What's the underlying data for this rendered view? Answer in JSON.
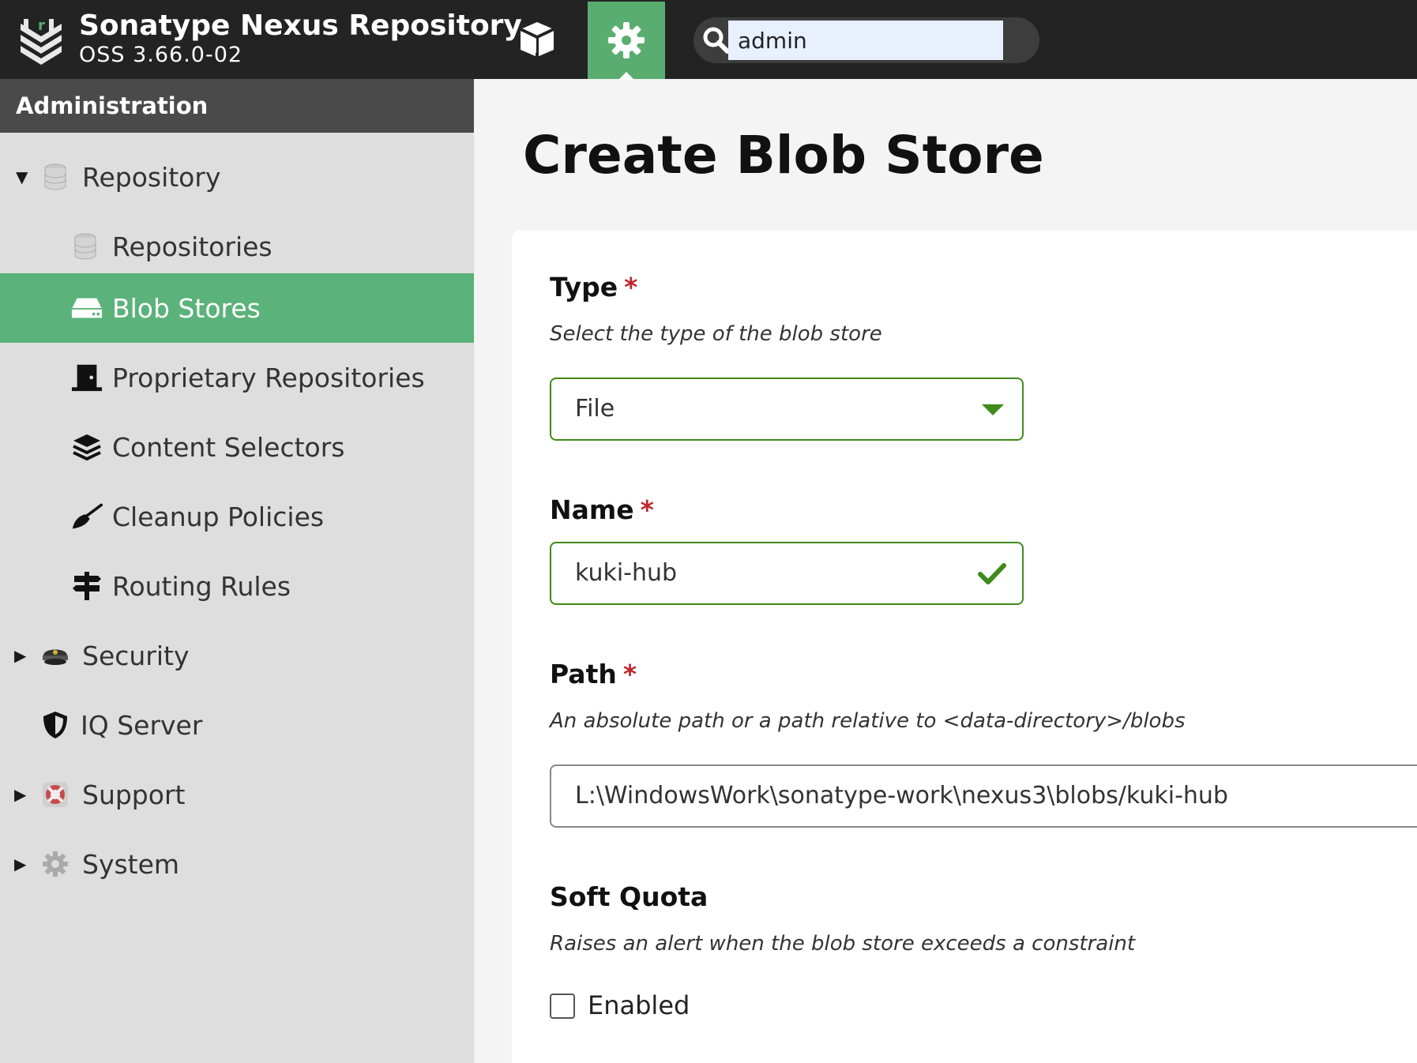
{
  "header": {
    "title": "Sonatype Nexus Repository",
    "version": "OSS 3.66.0-02",
    "search_value": "admin"
  },
  "sidebar": {
    "heading": "Administration",
    "items": [
      {
        "label": "Repository",
        "icon": "database-icon"
      },
      {
        "label": "Repositories",
        "icon": "database-icon"
      },
      {
        "label": "Blob Stores",
        "icon": "hard-drive-icon"
      },
      {
        "label": "Proprietary Repositories",
        "icon": "door-icon"
      },
      {
        "label": "Content Selectors",
        "icon": "layers-icon"
      },
      {
        "label": "Cleanup Policies",
        "icon": "broom-icon"
      },
      {
        "label": "Routing Rules",
        "icon": "signpost-icon"
      },
      {
        "label": "Security",
        "icon": "police-cap-icon"
      },
      {
        "label": "IQ Server",
        "icon": "shield-icon"
      },
      {
        "label": "Support",
        "icon": "lifebuoy-icon"
      },
      {
        "label": "System",
        "icon": "gear-icon"
      }
    ]
  },
  "main": {
    "title": "Create Blob Store",
    "type": {
      "label": "Type",
      "required": "*",
      "help": "Select the type of the blob store",
      "value": "File"
    },
    "name": {
      "label": "Name",
      "required": "*",
      "value": "kuki-hub"
    },
    "path": {
      "label": "Path",
      "required": "*",
      "help": "An absolute path or a path relative to <data-directory>/blobs",
      "value": "L:\\WindowsWork\\sonatype-work\\nexus3\\blobs/kuki-hub"
    },
    "soft_quota": {
      "label": "Soft Quota",
      "help": "Raises an alert when the blob store exceeds a constraint",
      "checkbox_label": "Enabled"
    }
  },
  "colors": {
    "accent_green": "#5bb27a",
    "header_bg": "#232323",
    "valid_green": "#3f8a1a",
    "required_red": "#c0262d"
  }
}
